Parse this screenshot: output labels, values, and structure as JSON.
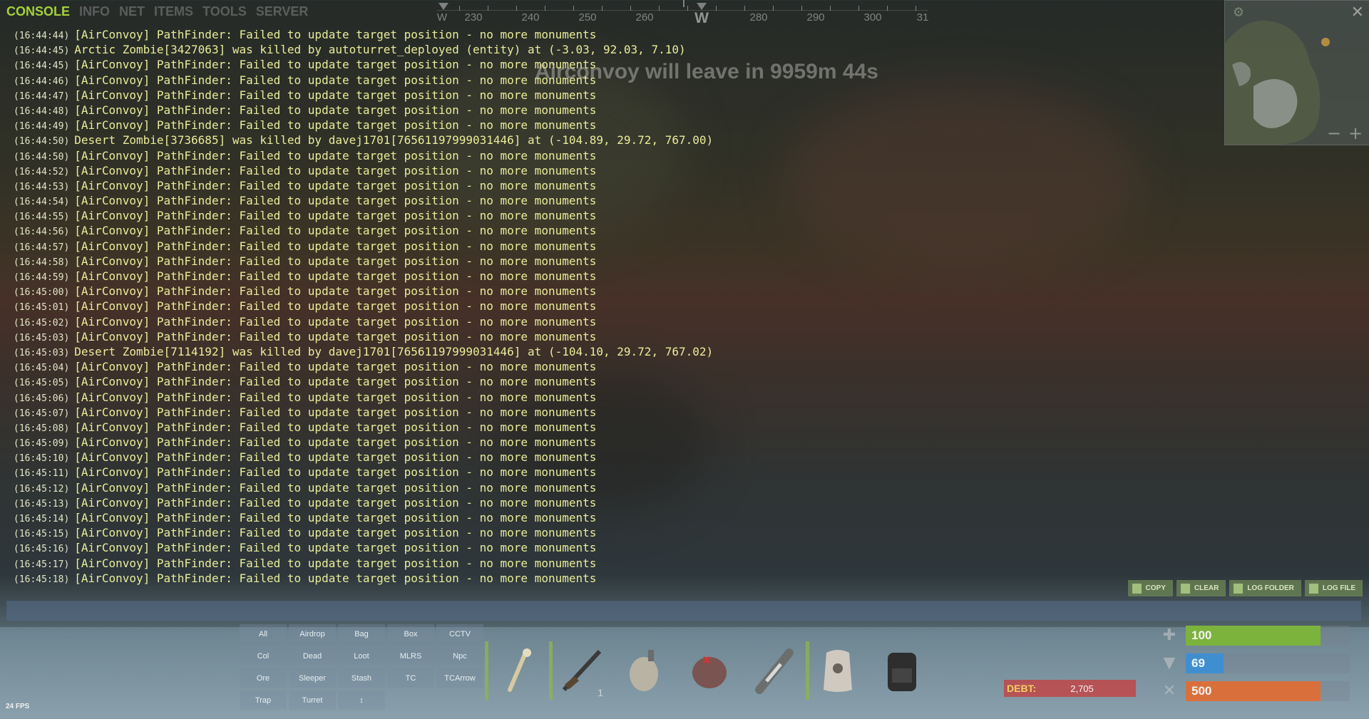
{
  "tabs": [
    {
      "label": "CONSOLE",
      "active": true
    },
    {
      "label": "INFO",
      "active": false
    },
    {
      "label": "NET",
      "active": false
    },
    {
      "label": "ITEMS",
      "active": false
    },
    {
      "label": "TOOLS",
      "active": false
    },
    {
      "label": "SERVER",
      "active": false
    }
  ],
  "compass": {
    "labels": [
      "W",
      "230",
      "240",
      "250",
      "260",
      "W",
      "280",
      "290",
      "300",
      "31"
    ]
  },
  "event_banner": "Airconvoy will leave in 9959m 44s",
  "log": [
    {
      "ts": "(16:44:44)",
      "msg": "[AirConvoy] PathFinder: Failed to update target position - no more monuments"
    },
    {
      "ts": "(16:44:45)",
      "msg": "Arctic Zombie[3427063] was killed by autoturret_deployed (entity) at (-3.03, 92.03, 7.10)"
    },
    {
      "ts": "(16:44:45)",
      "msg": "[AirConvoy] PathFinder: Failed to update target position - no more monuments"
    },
    {
      "ts": "(16:44:46)",
      "msg": "[AirConvoy] PathFinder: Failed to update target position - no more monuments"
    },
    {
      "ts": "(16:44:47)",
      "msg": "[AirConvoy] PathFinder: Failed to update target position - no more monuments"
    },
    {
      "ts": "(16:44:48)",
      "msg": "[AirConvoy] PathFinder: Failed to update target position - no more monuments"
    },
    {
      "ts": "(16:44:49)",
      "msg": "[AirConvoy] PathFinder: Failed to update target position - no more monuments"
    },
    {
      "ts": "(16:44:50)",
      "msg": "Desert Zombie[3736685] was killed by davej1701[76561197999031446] at (-104.89, 29.72, 767.00)"
    },
    {
      "ts": "(16:44:50)",
      "msg": "[AirConvoy] PathFinder: Failed to update target position - no more monuments"
    },
    {
      "ts": "(16:44:52)",
      "msg": "[AirConvoy] PathFinder: Failed to update target position - no more monuments"
    },
    {
      "ts": "(16:44:53)",
      "msg": "[AirConvoy] PathFinder: Failed to update target position - no more monuments"
    },
    {
      "ts": "(16:44:54)",
      "msg": "[AirConvoy] PathFinder: Failed to update target position - no more monuments"
    },
    {
      "ts": "(16:44:55)",
      "msg": "[AirConvoy] PathFinder: Failed to update target position - no more monuments"
    },
    {
      "ts": "(16:44:56)",
      "msg": "[AirConvoy] PathFinder: Failed to update target position - no more monuments"
    },
    {
      "ts": "(16:44:57)",
      "msg": "[AirConvoy] PathFinder: Failed to update target position - no more monuments"
    },
    {
      "ts": "(16:44:58)",
      "msg": "[AirConvoy] PathFinder: Failed to update target position - no more monuments"
    },
    {
      "ts": "(16:44:59)",
      "msg": "[AirConvoy] PathFinder: Failed to update target position - no more monuments"
    },
    {
      "ts": "(16:45:00)",
      "msg": "[AirConvoy] PathFinder: Failed to update target position - no more monuments"
    },
    {
      "ts": "(16:45:01)",
      "msg": "[AirConvoy] PathFinder: Failed to update target position - no more monuments"
    },
    {
      "ts": "(16:45:02)",
      "msg": "[AirConvoy] PathFinder: Failed to update target position - no more monuments"
    },
    {
      "ts": "(16:45:03)",
      "msg": "[AirConvoy] PathFinder: Failed to update target position - no more monuments"
    },
    {
      "ts": "(16:45:03)",
      "msg": "Desert Zombie[7114192] was killed by davej1701[76561197999031446] at (-104.10, 29.72, 767.02)"
    },
    {
      "ts": "(16:45:04)",
      "msg": "[AirConvoy] PathFinder: Failed to update target position - no more monuments"
    },
    {
      "ts": "(16:45:05)",
      "msg": "[AirConvoy] PathFinder: Failed to update target position - no more monuments"
    },
    {
      "ts": "(16:45:06)",
      "msg": "[AirConvoy] PathFinder: Failed to update target position - no more monuments"
    },
    {
      "ts": "(16:45:07)",
      "msg": "[AirConvoy] PathFinder: Failed to update target position - no more monuments"
    },
    {
      "ts": "(16:45:08)",
      "msg": "[AirConvoy] PathFinder: Failed to update target position - no more monuments"
    },
    {
      "ts": "(16:45:09)",
      "msg": "[AirConvoy] PathFinder: Failed to update target position - no more monuments"
    },
    {
      "ts": "(16:45:10)",
      "msg": "[AirConvoy] PathFinder: Failed to update target position - no more monuments"
    },
    {
      "ts": "(16:45:11)",
      "msg": "[AirConvoy] PathFinder: Failed to update target position - no more monuments"
    },
    {
      "ts": "(16:45:12)",
      "msg": "[AirConvoy] PathFinder: Failed to update target position - no more monuments"
    },
    {
      "ts": "(16:45:13)",
      "msg": "[AirConvoy] PathFinder: Failed to update target position - no more monuments"
    },
    {
      "ts": "(16:45:14)",
      "msg": "[AirConvoy] PathFinder: Failed to update target position - no more monuments"
    },
    {
      "ts": "(16:45:15)",
      "msg": "[AirConvoy] PathFinder: Failed to update target position - no more monuments"
    },
    {
      "ts": "(16:45:16)",
      "msg": "[AirConvoy] PathFinder: Failed to update target position - no more monuments"
    },
    {
      "ts": "(16:45:17)",
      "msg": "[AirConvoy] PathFinder: Failed to update target position - no more monuments"
    },
    {
      "ts": "(16:45:18)",
      "msg": "[AirConvoy] PathFinder: Failed to update target position - no more monuments"
    }
  ],
  "console_buttons": [
    {
      "label": "COPY",
      "icon": "copy-icon"
    },
    {
      "label": "CLEAR",
      "icon": "clear-icon"
    },
    {
      "label": "LOG FOLDER",
      "icon": "folder-icon"
    },
    {
      "label": "LOG FILE",
      "icon": "file-icon"
    }
  ],
  "console_input": {
    "value": "",
    "placeholder": ""
  },
  "filters": [
    "All",
    "Airdrop",
    "Bag",
    "Box",
    "CCTV",
    "Col",
    "Dead",
    "Loot",
    "MLRS",
    "Npc",
    "Ore",
    "Sleeper",
    "Stash",
    "TC",
    "TCArrow",
    "Trap",
    "Turret",
    "↕"
  ],
  "hotbar": [
    {
      "icon": "bone-club-icon",
      "count": "",
      "selected_bar": true
    },
    {
      "icon": "rifle-icon",
      "count": "1",
      "selected_bar": true
    },
    {
      "icon": "grenade-icon",
      "count": "",
      "selected_bar": false
    },
    {
      "icon": "medkit-icon",
      "count": "",
      "selected_bar": false
    },
    {
      "icon": "syringe-icon",
      "count": "",
      "selected_bar": false
    },
    {
      "icon": "hazmat-icon",
      "count": "",
      "selected_bar": true
    },
    {
      "icon": "backpack-icon",
      "count": "",
      "selected_bar": false
    }
  ],
  "debt": {
    "label": "DEBT:",
    "value": "2,705"
  },
  "stats": [
    {
      "icon": "health-icon",
      "value": "100",
      "fill": 0.82,
      "color": "#7cb33d"
    },
    {
      "icon": "water-icon",
      "value": "69",
      "fill": 0.23,
      "color": "#3f8fd0"
    },
    {
      "icon": "food-icon",
      "value": "500",
      "fill": 0.82,
      "color": "#d9703c"
    }
  ],
  "fps": "24 FPS",
  "colors": {
    "accent": "#a4d13b",
    "log_text": "#e9ec9a"
  }
}
